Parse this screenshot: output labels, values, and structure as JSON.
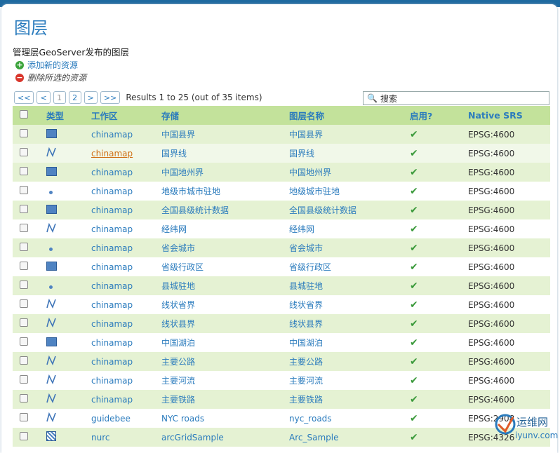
{
  "page": {
    "title": "图层",
    "subtitle": "管理层GeoServer发布的图层",
    "add_resource": "添加新的资源",
    "remove_selected": "删除所选的资源"
  },
  "pager": {
    "first": "<<",
    "prev": "<",
    "pages": [
      "1",
      "2"
    ],
    "next": ">",
    "last": ">>",
    "results": "Results 1 to 25 (out of 35 items)"
  },
  "search": {
    "label": "搜索"
  },
  "table": {
    "headers": {
      "type": "类型",
      "workspace": "工作区",
      "store": "存储",
      "layer": "图层名称",
      "enabled": "启用?",
      "srs": "Native SRS"
    },
    "rows": [
      {
        "type": "polygon",
        "workspace": "chinamap",
        "store": "中国县界",
        "layer": "中国县界",
        "srs": "EPSG:4600"
      },
      {
        "type": "line",
        "workspace": "chinamap",
        "store": "国界线",
        "layer": "国界线",
        "srs": "EPSG:4600"
      },
      {
        "type": "polygon",
        "workspace": "chinamap",
        "store": "中国地州界",
        "layer": "中国地州界",
        "srs": "EPSG:4600"
      },
      {
        "type": "point",
        "workspace": "chinamap",
        "store": "地级市城市驻地",
        "layer": "地级城市驻地",
        "srs": "EPSG:4600"
      },
      {
        "type": "polygon",
        "workspace": "chinamap",
        "store": "全国县级统计数据",
        "layer": "全国县级统计数据",
        "srs": "EPSG:4600"
      },
      {
        "type": "line",
        "workspace": "chinamap",
        "store": "经纬网",
        "layer": "经纬网",
        "srs": "EPSG:4600"
      },
      {
        "type": "point",
        "workspace": "chinamap",
        "store": "省会城市",
        "layer": "省会城市",
        "srs": "EPSG:4600"
      },
      {
        "type": "polygon",
        "workspace": "chinamap",
        "store": "省级行政区",
        "layer": "省级行政区",
        "srs": "EPSG:4600"
      },
      {
        "type": "point",
        "workspace": "chinamap",
        "store": "县城驻地",
        "layer": "县城驻地",
        "srs": "EPSG:4600"
      },
      {
        "type": "line",
        "workspace": "chinamap",
        "store": "线状省界",
        "layer": "线状省界",
        "srs": "EPSG:4600"
      },
      {
        "type": "line",
        "workspace": "chinamap",
        "store": "线状县界",
        "layer": "线状县界",
        "srs": "EPSG:4600"
      },
      {
        "type": "polygon",
        "workspace": "chinamap",
        "store": "中国湖泊",
        "layer": "中国湖泊",
        "srs": "EPSG:4600"
      },
      {
        "type": "line",
        "workspace": "chinamap",
        "store": "主要公路",
        "layer": "主要公路",
        "srs": "EPSG:4600"
      },
      {
        "type": "line",
        "workspace": "chinamap",
        "store": "主要河流",
        "layer": "主要河流",
        "srs": "EPSG:4600"
      },
      {
        "type": "line",
        "workspace": "chinamap",
        "store": "主要铁路",
        "layer": "主要铁路",
        "srs": "EPSG:4600"
      },
      {
        "type": "line",
        "workspace": "guidebee",
        "store": "NYC roads",
        "layer": "nyc_roads",
        "srs": "EPSG:2908"
      },
      {
        "type": "raster",
        "workspace": "nurc",
        "store": "arcGridSample",
        "layer": "Arc_Sample",
        "srs": "EPSG:4326"
      }
    ],
    "enabled_mark": "✔"
  },
  "watermark": {
    "text1": "运维网",
    "text2": "iyunv.com"
  },
  "colors": {
    "header_bg": "#c3e29b",
    "row_alt": "#e5f2d3",
    "link": "#2a7bbd",
    "accent_bar": "#1f6aa0"
  }
}
